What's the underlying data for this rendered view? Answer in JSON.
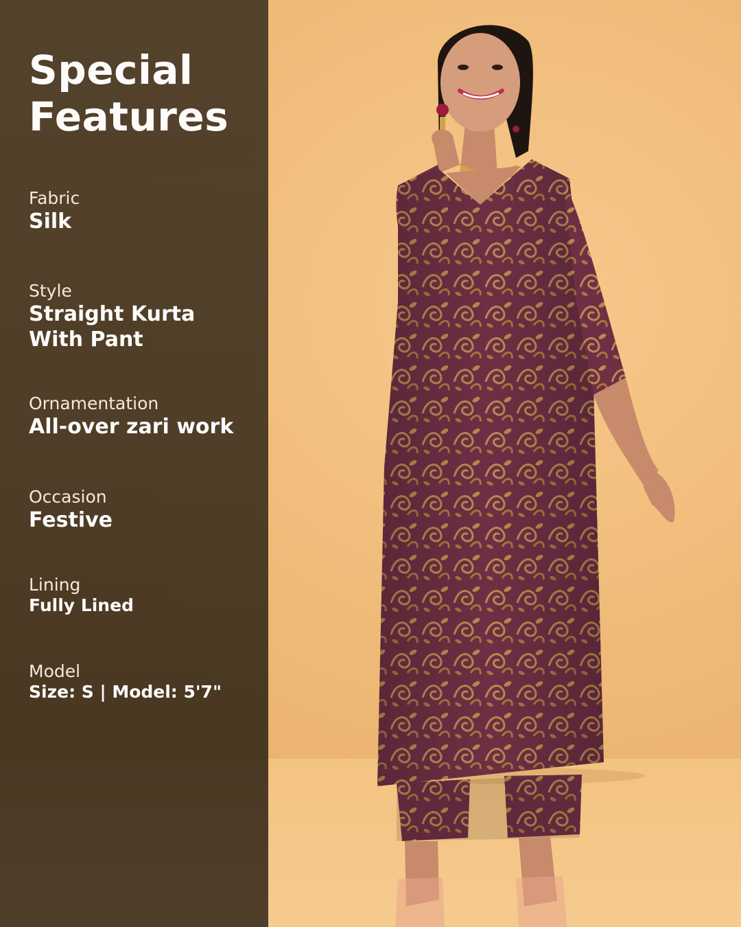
{
  "title_lines": [
    "Special",
    "Features"
  ],
  "features": [
    {
      "label": "Fabric",
      "value_lines": [
        "Silk"
      ]
    },
    {
      "label": "Style",
      "value_lines": [
        "Straight Kurta",
        "With Pant"
      ]
    },
    {
      "label": "Ornamentation",
      "value_lines": [
        "All-over zari work"
      ]
    },
    {
      "label": "Occasion",
      "value_lines": [
        "Festive"
      ]
    },
    {
      "label": "Lining",
      "value_lines": [
        "Fully Lined"
      ]
    },
    {
      "label": "Model",
      "value_lines": [
        "Size: S |  Model: 5'7\""
      ]
    }
  ],
  "colors": {
    "panel": "#4a3a25",
    "backdrop": "#f0bd7c",
    "kurta": "#6b2f43",
    "zari": "#b88a4e"
  }
}
